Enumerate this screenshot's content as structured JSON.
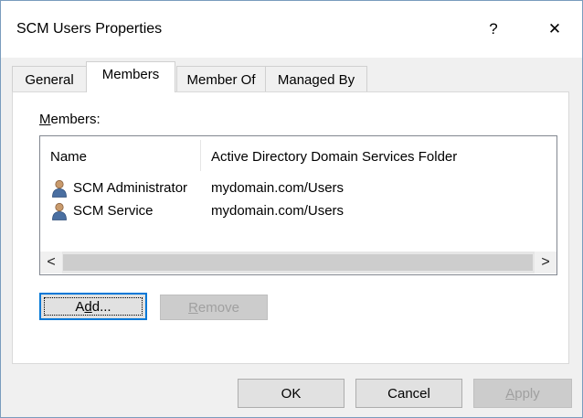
{
  "window": {
    "title": "SCM Users Properties",
    "help_label": "?",
    "close_label": "✕"
  },
  "tabs": [
    {
      "label": "General",
      "active": false
    },
    {
      "label": "Members",
      "active": true
    },
    {
      "label": "Member Of",
      "active": false
    },
    {
      "label": "Managed By",
      "active": false
    }
  ],
  "members": {
    "label_accel": "M",
    "label_rest": "embers:",
    "columns": [
      "Name",
      "Active Directory Domain Services Folder"
    ],
    "rows": [
      {
        "name": "SCM Administrator",
        "folder": "mydomain.com/Users",
        "icon": "user-icon"
      },
      {
        "name": "SCM Service",
        "folder": "mydomain.com/Users",
        "icon": "user-icon"
      }
    ],
    "scroll_left": "<",
    "scroll_right": ">"
  },
  "actions": {
    "add_pre": "A",
    "add_accel": "d",
    "add_post": "d...",
    "remove_accel": "R",
    "remove_rest": "emove"
  },
  "footer": {
    "ok_label": "OK",
    "cancel_label": "Cancel",
    "apply_accel": "A",
    "apply_rest": "pply"
  },
  "colors": {
    "focus_border": "#0078d7",
    "disabled_text": "#a0a0a0",
    "window_border": "#7a9cbd"
  }
}
